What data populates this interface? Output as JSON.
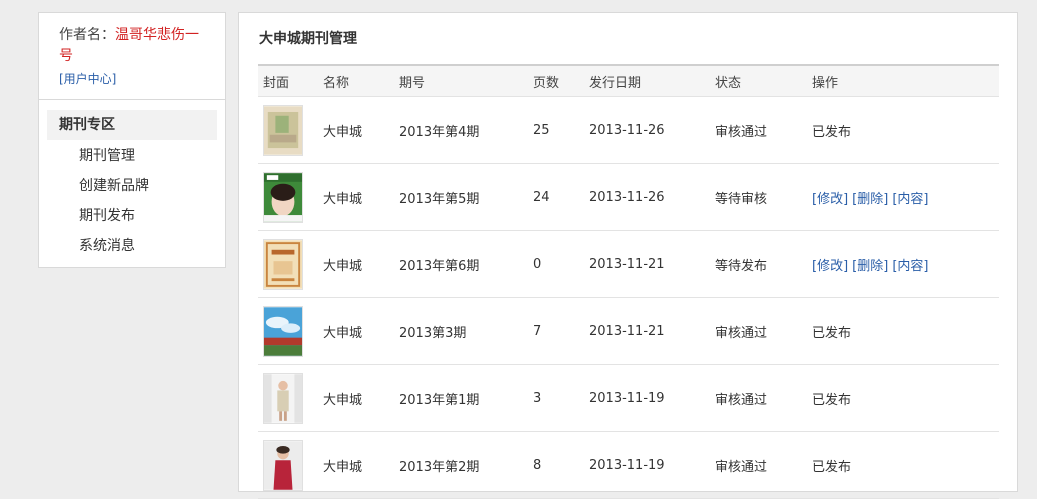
{
  "sidebar": {
    "author_label": "作者名：",
    "author_name": "温哥华悲伤一号",
    "user_center": "[用户中心]",
    "section_title": "期刊专区",
    "items": [
      {
        "label": "期刊管理"
      },
      {
        "label": "创建新品牌"
      },
      {
        "label": "期刊发布"
      },
      {
        "label": "系统消息"
      }
    ]
  },
  "main": {
    "title": "大申城期刊管理",
    "columns": [
      "封面",
      "名称",
      "期号",
      "页数",
      "发行日期",
      "状态",
      "操作"
    ],
    "rows": [
      {
        "name": "大申城",
        "issue": "2013年第4期",
        "pages": "25",
        "date": "2013-11-26",
        "status": "审核通过",
        "action": "已发布"
      },
      {
        "name": "大申城",
        "issue": "2013年第5期",
        "pages": "24",
        "date": "2013-11-26",
        "status": "等待审核",
        "links": [
          "[修改]",
          "[删除]",
          "[内容]"
        ]
      },
      {
        "name": "大申城",
        "issue": "2013年第6期",
        "pages": "0",
        "date": "2013-11-21",
        "status": "等待发布",
        "links": [
          "[修改]",
          "[删除]",
          "[内容]"
        ]
      },
      {
        "name": "大申城",
        "issue": "2013第3期",
        "pages": "7",
        "date": "2013-11-21",
        "status": "审核通过",
        "action": "已发布"
      },
      {
        "name": "大申城",
        "issue": "2013年第1期",
        "pages": "3",
        "date": "2013-11-19",
        "status": "审核通过",
        "action": "已发布"
      },
      {
        "name": "大申城",
        "issue": "2013年第2期",
        "pages": "8",
        "date": "2013-11-19",
        "status": "审核通过",
        "action": "已发布"
      }
    ]
  }
}
